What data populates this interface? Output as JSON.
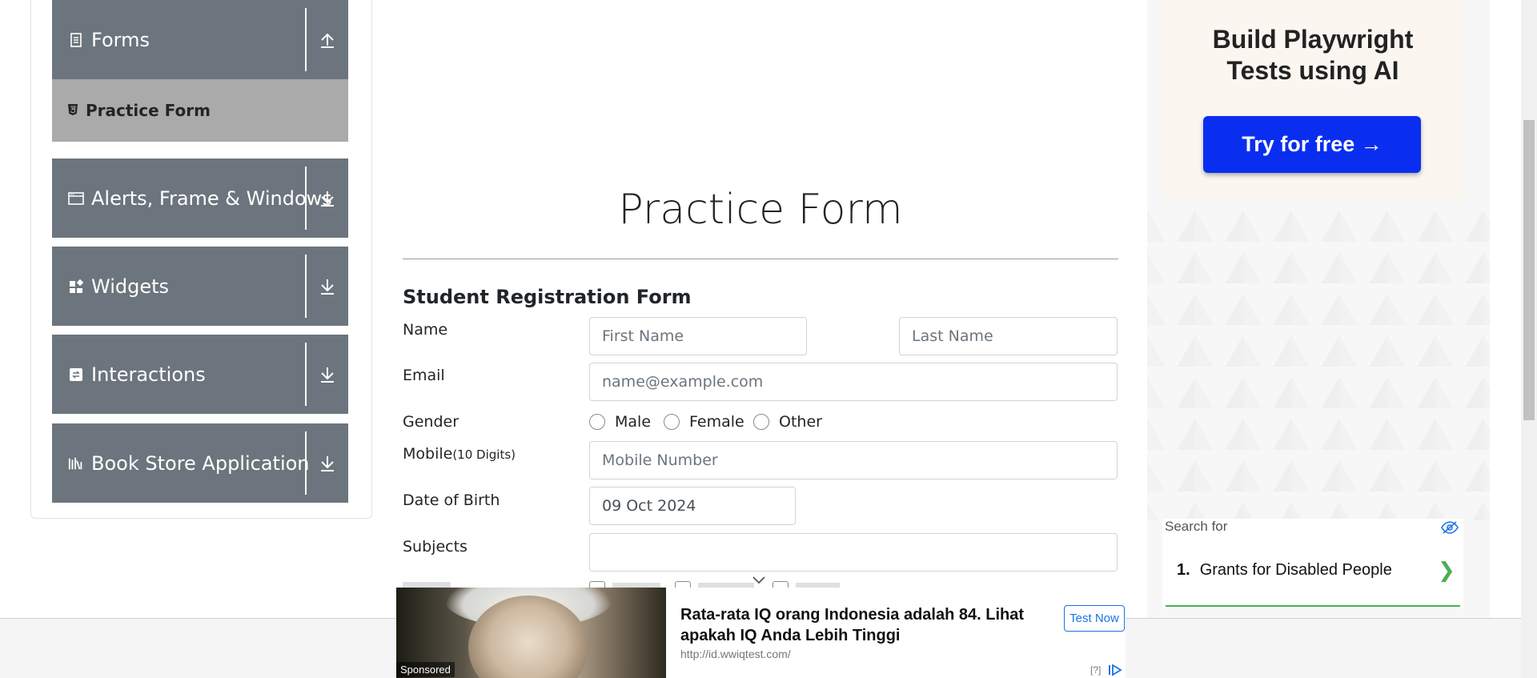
{
  "sidebar": {
    "forms": {
      "label": "Forms",
      "icon": "form-icon",
      "arrow": "collapse-up-icon"
    },
    "practice_form": {
      "label": "Practice Form",
      "icon": "html5-icon"
    },
    "alerts": {
      "label": "Alerts, Frame & Windows",
      "icon": "window-icon",
      "arrow": "expand-down-icon"
    },
    "widgets": {
      "label": "Widgets",
      "icon": "widgets-icon",
      "arrow": "expand-down-icon"
    },
    "interactions": {
      "label": "Interactions",
      "icon": "interactions-icon",
      "arrow": "expand-down-icon"
    },
    "bookstore": {
      "label": "Book Store Application",
      "icon": "books-icon",
      "arrow": "expand-down-icon"
    }
  },
  "main": {
    "title": "Practice Form",
    "form_heading": "Student Registration Form",
    "name_label": "Name",
    "first_name_placeholder": "First Name",
    "last_name_placeholder": "Last Name",
    "email_label": "Email",
    "email_placeholder": "name@example.com",
    "gender_label": "Gender",
    "gender_options": [
      "Male",
      "Female",
      "Other"
    ],
    "mobile_label": "Mobile",
    "mobile_hint": "(10 Digits)",
    "mobile_placeholder": "Mobile Number",
    "dob_label": "Date of Birth",
    "dob_value": "09 Oct 2024",
    "subjects_label": "Subjects",
    "subjects_value": ""
  },
  "right_ad": {
    "title_line1": "Build Playwright",
    "title_line2": "Tests using AI",
    "button": "Try for free →",
    "search_for": "Search for",
    "search_item_number": "1.",
    "search_item_text": "Grants for Disabled People",
    "search_item_chevron": "❯"
  },
  "bottom_ad": {
    "sponsored": "Sponsored",
    "headline": "Rata-rata IQ orang Indonesia adalah 84. Lihat apakah IQ Anda Lebih Tinggi",
    "url": "http://id.wwiqtest.com/",
    "cta": "Test Now",
    "info": "[?]"
  },
  "colors": {
    "nav_group_bg": "#6c757d",
    "nav_active_bg": "#aaaaaa",
    "ad_button_blue": "#0a2ef0",
    "search_accent": "#4caf50"
  }
}
